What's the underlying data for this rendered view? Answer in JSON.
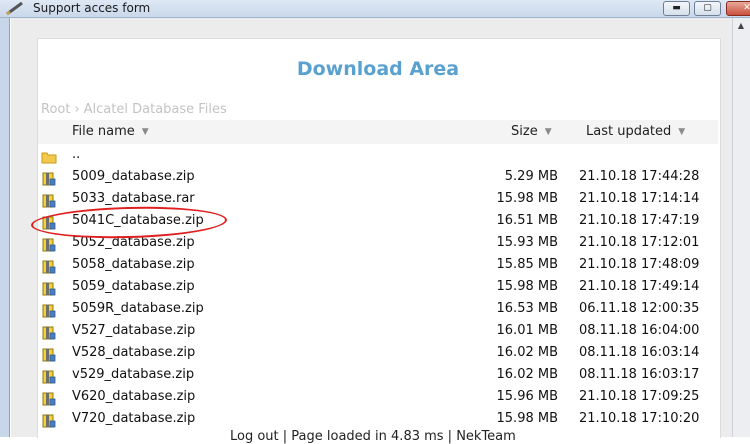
{
  "window": {
    "title": "Support acces form",
    "minimize": "▬",
    "maximize": "▢",
    "close": "✕"
  },
  "page": {
    "heading": "Download Area",
    "breadcrumb": [
      "Root",
      "Alcatel Database Files"
    ],
    "breadcrumb_separator": "›",
    "columns": {
      "name": "File name",
      "size": "Size",
      "updated": "Last updated"
    },
    "sort_arrow": "▼",
    "files": [
      {
        "icon": "folder-up-icon",
        "name": "..",
        "size": "",
        "updated": ""
      },
      {
        "icon": "zip-file-icon",
        "name": "5009_database.zip",
        "size": "5.29 MB",
        "updated": "21.10.18 17:44:28"
      },
      {
        "icon": "zip-file-icon",
        "name": "5033_database.rar",
        "size": "15.98 MB",
        "updated": "21.10.18 17:14:14"
      },
      {
        "icon": "zip-file-icon",
        "name": "5041C_database.zip",
        "size": "16.51 MB",
        "updated": "21.10.18 17:47:19"
      },
      {
        "icon": "zip-file-icon",
        "name": "5052_database.zip",
        "size": "15.93 MB",
        "updated": "21.10.18 17:12:01"
      },
      {
        "icon": "zip-file-icon",
        "name": "5058_database.zip",
        "size": "15.85 MB",
        "updated": "21.10.18 17:48:09"
      },
      {
        "icon": "zip-file-icon",
        "name": "5059_database.zip",
        "size": "15.98 MB",
        "updated": "21.10.18 17:49:14"
      },
      {
        "icon": "zip-file-icon",
        "name": "5059R_database.zip",
        "size": "16.53 MB",
        "updated": "06.11.18 12:00:35"
      },
      {
        "icon": "zip-file-icon",
        "name": "V527_database.zip",
        "size": "16.01 MB",
        "updated": "08.11.18 16:04:00"
      },
      {
        "icon": "zip-file-icon",
        "name": "V528_database.zip",
        "size": "16.02 MB",
        "updated": "08.11.18 16:03:14"
      },
      {
        "icon": "zip-file-icon",
        "name": "v529_database.zip",
        "size": "16.02 MB",
        "updated": "08.11.18 16:03:17"
      },
      {
        "icon": "zip-file-icon",
        "name": "V620_database.zip",
        "size": "15.96 MB",
        "updated": "21.10.18 17:09:25"
      },
      {
        "icon": "zip-file-icon",
        "name": "V720_database.zip",
        "size": "15.98 MB",
        "updated": "21.10.18 17:10:20"
      }
    ],
    "footer": "Log out | Page loaded in 4.83 ms | NekTeam"
  },
  "colors": {
    "heading": "#5aa1cf",
    "annotation_ring": "#e02020",
    "breadcrumb": "#c3c3c3"
  }
}
